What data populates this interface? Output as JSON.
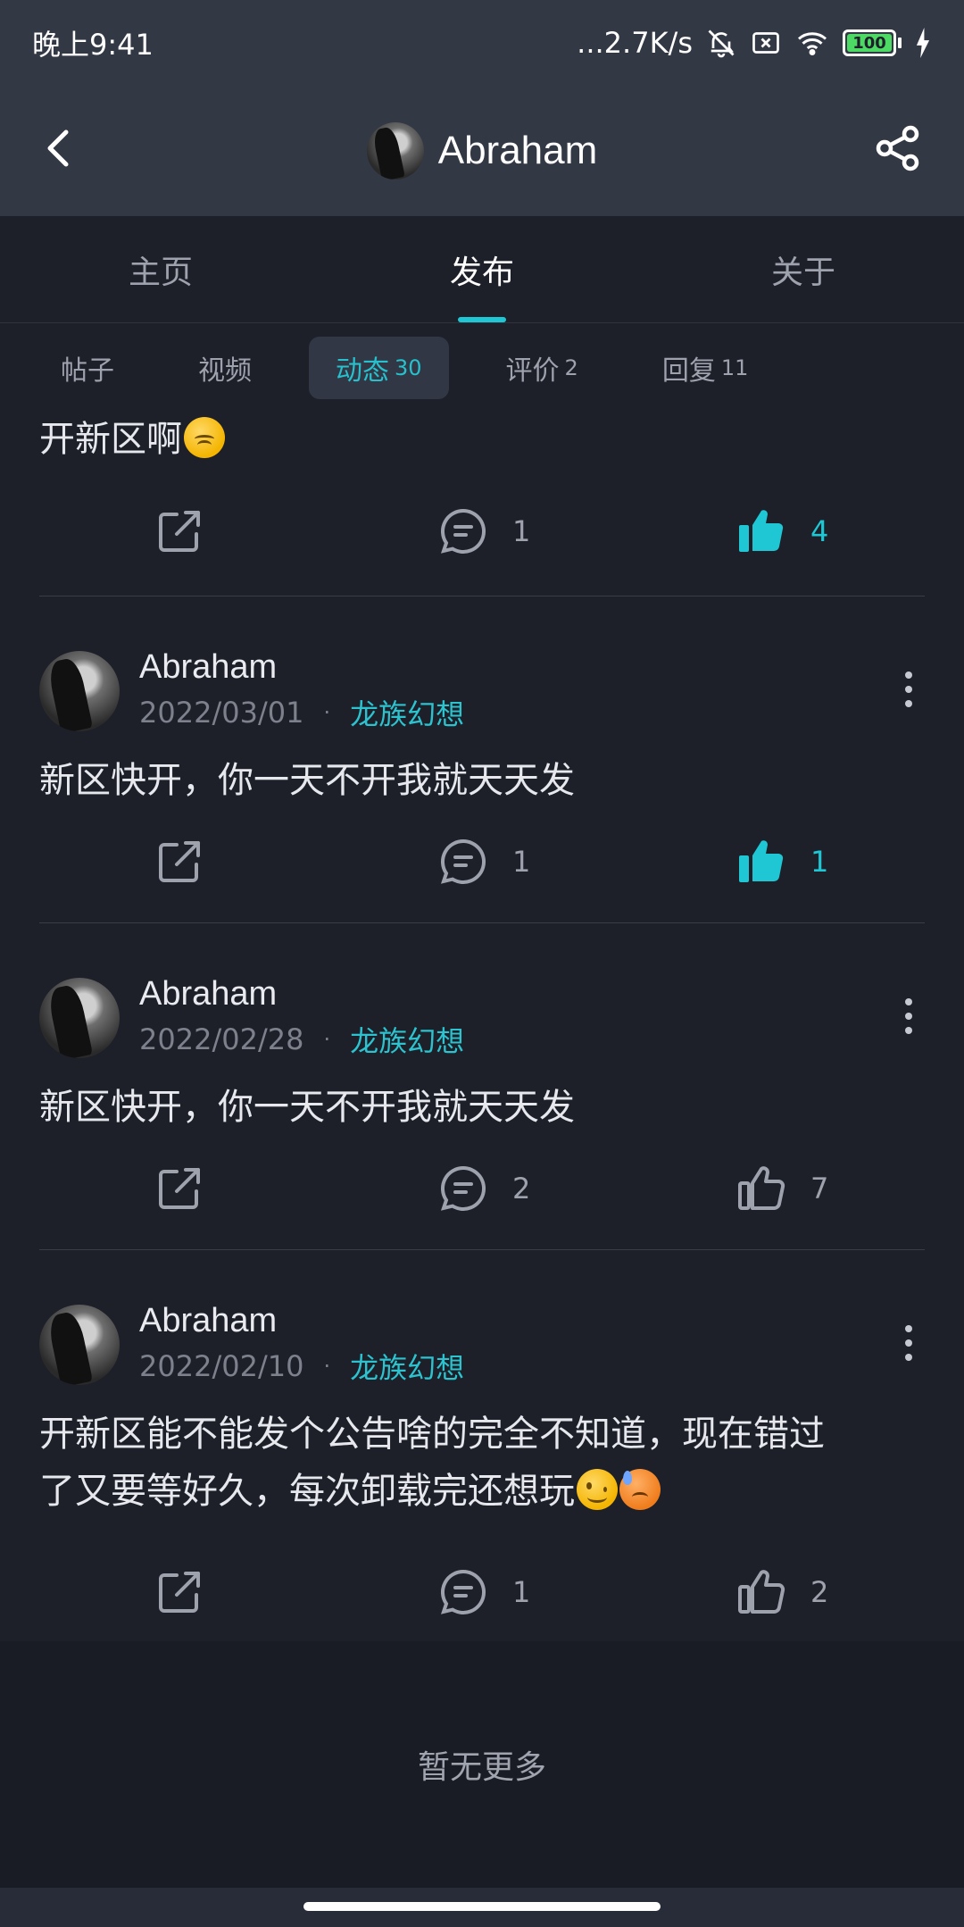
{
  "status_bar": {
    "time": "晚上9:41",
    "network_speed": "...2.7K/s",
    "battery": "100"
  },
  "header": {
    "title": "Abraham",
    "back_icon": "back-arrow-icon",
    "share_icon": "share-icon"
  },
  "main_tabs": [
    {
      "label": "主页"
    },
    {
      "label": "发布"
    },
    {
      "label": "关于"
    }
  ],
  "sub_tabs": [
    {
      "label": "帖子",
      "count": ""
    },
    {
      "label": "视频",
      "count": ""
    },
    {
      "label": "动态",
      "count": "30"
    },
    {
      "label": "评价",
      "count": "2"
    },
    {
      "label": "回复",
      "count": "11"
    }
  ],
  "posts": [
    {
      "text": "开新区啊",
      "comments": "1",
      "likes": "4",
      "liked": true
    },
    {
      "author": "Abraham",
      "date": "2022/03/01",
      "game": "龙族幻想",
      "text": "新区快开，你一天不开我就天天发",
      "comments": "1",
      "likes": "1",
      "liked": true
    },
    {
      "author": "Abraham",
      "date": "2022/02/28",
      "game": "龙族幻想",
      "text": "新区快开，你一天不开我就天天发",
      "comments": "2",
      "likes": "7",
      "liked": false
    },
    {
      "author": "Abraham",
      "date": "2022/02/10",
      "game": "龙族幻想",
      "text_line1": "开新区能不能发个公告啥的完全不知道，现在错过",
      "text_line2": "了又要等好久，每次卸载完还想玩",
      "comments": "1",
      "likes": "2",
      "liked": false
    }
  ],
  "footer": {
    "end_text": "暂无更多"
  },
  "colors": {
    "accent": "#1ec7d3",
    "background": "#1d1f29",
    "header": "#333845"
  }
}
